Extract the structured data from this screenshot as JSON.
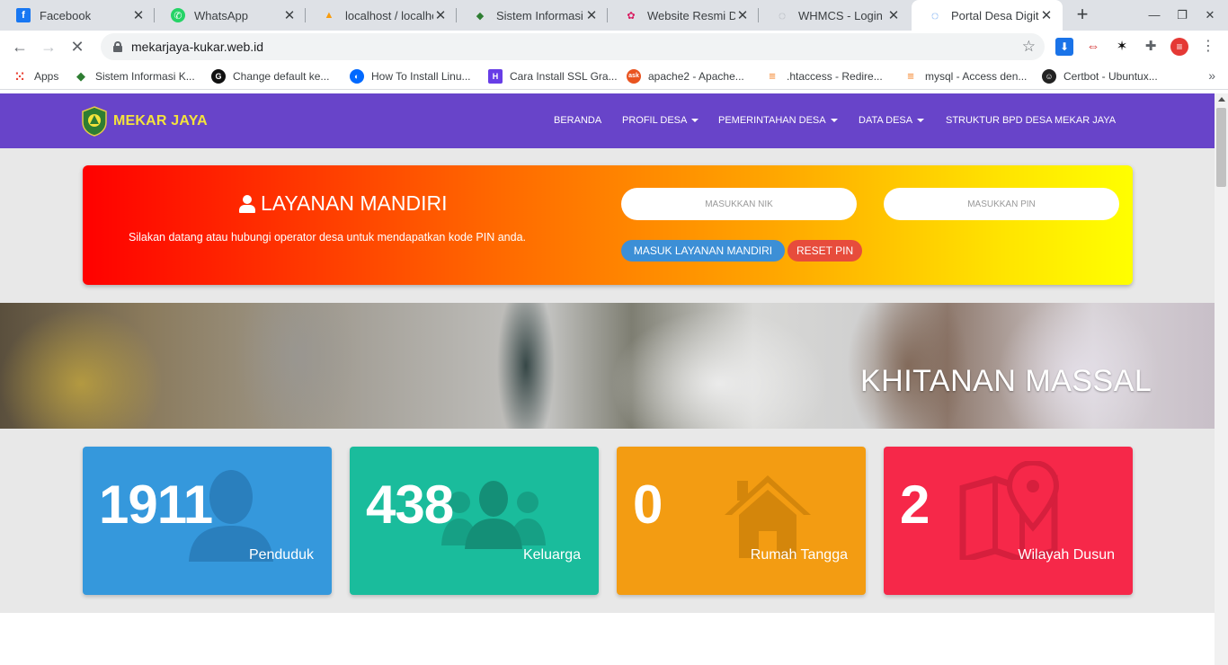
{
  "browser": {
    "tabs": [
      {
        "title": "Facebook",
        "icon": "facebook-icon",
        "color": "#1877f2",
        "glyph": "f"
      },
      {
        "title": "WhatsApp",
        "icon": "whatsapp-icon",
        "color": "#25d366",
        "glyph": "✆"
      },
      {
        "title": "localhost / localhos",
        "icon": "phpmyadmin-icon",
        "color": "#f89c0e",
        "glyph": "▲"
      },
      {
        "title": "Sistem Informasi D",
        "icon": "shield-emblem-icon",
        "color": "#2e7d32",
        "glyph": "◆"
      },
      {
        "title": "Website Resmi Des",
        "icon": "colorful-flower-icon",
        "color": "#d81b60",
        "glyph": "✿"
      },
      {
        "title": "WHMCS - Login",
        "icon": "loading-spinner-icon",
        "color": "#9aa0a6",
        "glyph": "◌"
      },
      {
        "title": "Portal Desa Digital",
        "icon": "loading-spinner-icon",
        "color": "#1a73e8",
        "glyph": "◌"
      }
    ],
    "url": "mekarjaya-kukar.web.id",
    "bookmarks": [
      {
        "label": "Apps",
        "icon": "apps-grid-icon",
        "color": "#ea4335",
        "glyph": "⋮"
      },
      {
        "label": "Sistem Informasi K...",
        "icon": "emblem-icon",
        "color": "#2e7d32",
        "glyph": "◆"
      },
      {
        "label": "Change default ke...",
        "icon": "github-icon",
        "color": "#111111",
        "glyph": "G"
      },
      {
        "label": "How To Install Linu...",
        "icon": "digitalocean-icon",
        "color": "#0069ff",
        "glyph": "◐"
      },
      {
        "label": "Cara Install SSL Gra...",
        "icon": "hostinger-icon",
        "color": "#673de6",
        "glyph": "H"
      },
      {
        "label": "apache2 - Apache...",
        "icon": "askubuntu-icon",
        "color": "#e95420",
        "glyph": "ask"
      },
      {
        "label": ".htaccess - Redire...",
        "icon": "stackoverflow-icon",
        "color": "#f48024",
        "glyph": "≡"
      },
      {
        "label": "mysql - Access den...",
        "icon": "stackoverflow-icon",
        "color": "#f48024",
        "glyph": "≡"
      },
      {
        "label": "Certbot - Ubuntux...",
        "icon": "certbot-icon",
        "color": "#222222",
        "glyph": "☺"
      }
    ]
  },
  "site": {
    "brand": "MEKAR JAYA",
    "menu": {
      "beranda": "BERANDA",
      "profil": "PROFIL DESA",
      "pemerintahan": "PEMERINTAHAN DESA",
      "data": "DATA DESA",
      "bpd": "STRUKTUR BPD DESA MEKAR JAYA"
    },
    "mandiri": {
      "title": "LAYANAN MANDIRI",
      "subtitle": "Silakan datang atau hubungi operator desa untuk mendapatkan kode PIN anda.",
      "nik_placeholder": "MASUKKAN NIK",
      "pin_placeholder": "MASUKKAN PIN",
      "login_button": "MASUK LAYANAN MANDIRI",
      "reset_button": "RESET PIN"
    },
    "banner_caption": "KHITANAN MASSAL",
    "stats": [
      {
        "value": "1911",
        "label": "Penduduk",
        "color": "#3598dc"
      },
      {
        "value": "438",
        "label": "Keluarga",
        "color": "#1abc9c"
      },
      {
        "value": "0",
        "label": "Rumah Tangga",
        "color": "#f39c12"
      },
      {
        "value": "2",
        "label": "Wilayah Dusun",
        "color": "#f62849"
      }
    ]
  }
}
